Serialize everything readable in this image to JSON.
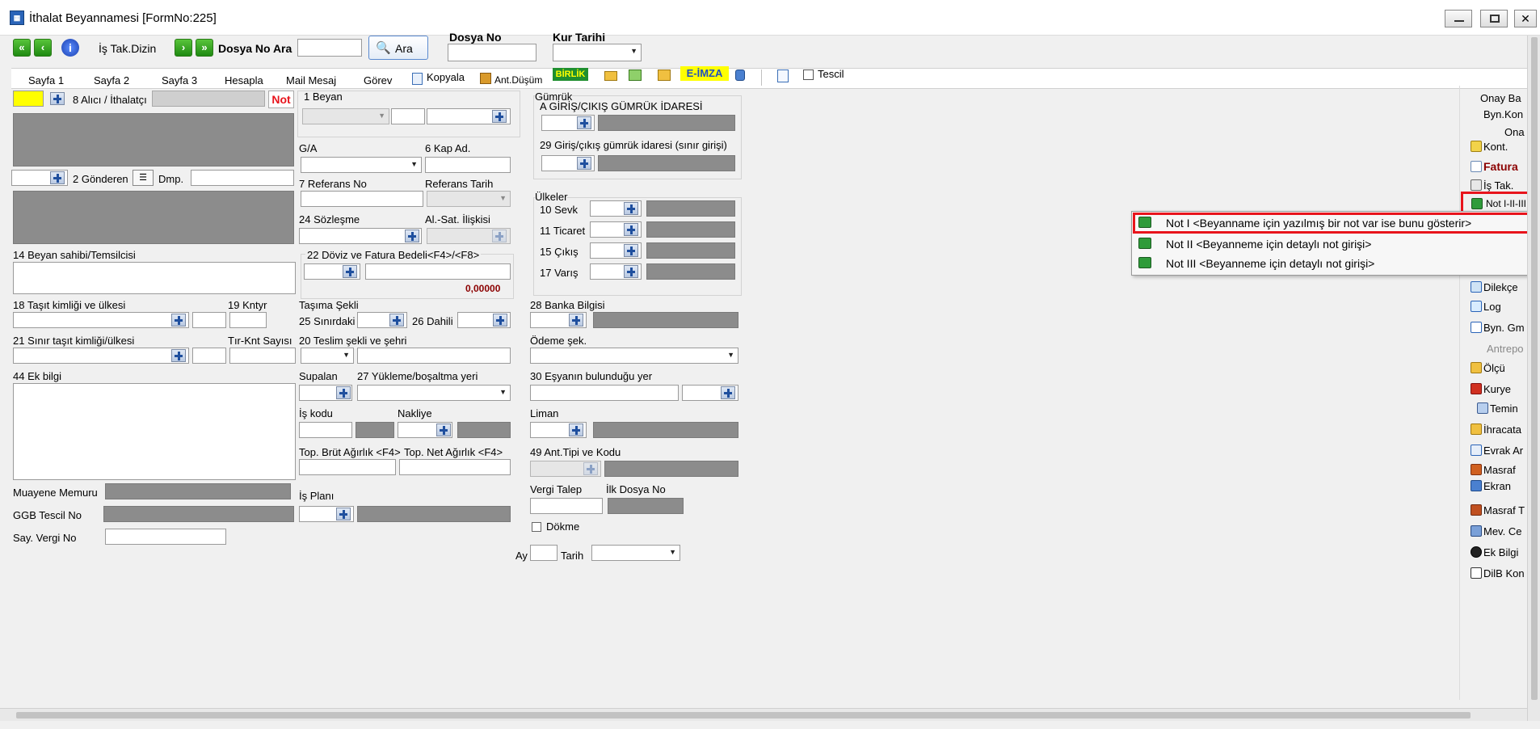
{
  "window": {
    "title": "İthalat Beyannamesi [FormNo:225]"
  },
  "toolbar": {
    "is_tak_dizin": "İş Tak.Dizin",
    "dosya_no_ara": "Dosya No Ara",
    "ara_button": "Ara",
    "dosya_no_label": "Dosya No",
    "kur_tarihi_label": "Kur Tarihi"
  },
  "tabs": [
    {
      "label": "Sayfa 1"
    },
    {
      "label": "Sayfa 2"
    },
    {
      "label": "Sayfa 3"
    },
    {
      "label": "Hesapla"
    },
    {
      "label": "Mail Mesaj"
    },
    {
      "label": "Görev"
    },
    {
      "label": "Kopyala"
    },
    {
      "label": "Ant.Düşüm"
    },
    {
      "label": "BİRLİK"
    },
    {
      "label": "E-İMZA"
    },
    {
      "label": "Tescil"
    }
  ],
  "left": {
    "alici": "8 Alıcı / İthalatçı",
    "not": "Not",
    "gonderen": "2 Gönderen",
    "dmp": "Dmp.",
    "beyan_sahibi": "14 Beyan sahibi/Temsilcisi",
    "tasit_kimligi": "18 Taşıt kimliği ve ülkesi",
    "kntyr": "19 Kntyr",
    "sinir_tasit": "21 Sınır taşıt kimliği/ülkesi",
    "tir_kont": "Tır-Knt Sayısı",
    "ek_bilgi": "44 Ek bilgi",
    "muayene": "Muayene Memuru",
    "ggb_tescil": "GGB Tescil No",
    "say_vergi": "Say. Vergi No"
  },
  "middle": {
    "beyan": "1 Beyan",
    "ga": "G/A",
    "kap_ad": "6 Kap Ad.",
    "referans_no": "7 Referans No",
    "referans_tarih": "Referans Tarih",
    "sozlesme": "24 Sözleşme",
    "alsat": "Al.-Sat. İlişkisi",
    "doviz": "22 Döviz ve Fatura Bedeli<F4>/<F8>",
    "doviz_value": "0,00000",
    "tasima_sekli": "Taşıma Şekli",
    "sinirdaki": "25 Sınırdaki",
    "dahili": "26 Dahili",
    "teslim": "20 Teslim şekli ve şehri",
    "supalan": "Supalan",
    "yukleme": "27 Yükleme/boşaltma yeri",
    "is_kodu": "İş kodu",
    "nakliye": "Nakliye",
    "brut": "Top. Brüt Ağırlık <F4>",
    "net": "Top. Net Ağırlık <F4>",
    "is_plani": "İş Planı"
  },
  "right": {
    "gumruk": "Gümrük",
    "giris_cikis": "A GİRİŞ/ÇIKIŞ GÜMRÜK İDARESİ",
    "sinir_girisi": "29 Giriş/çıkış gümrük idaresi (sınır girişi)",
    "ulkeler": "Ülkeler",
    "sevk": "10 Sevk",
    "ticaret": "11 Ticaret",
    "cikis": "15 Çıkış",
    "varis": "17 Varış",
    "banka": "28 Banka Bilgisi",
    "odeme": "Ödeme şek.",
    "esyanin": "30 Eşyanın bulunduğu yer",
    "liman": "Liman",
    "ant_tipi": "49 Ant.Tipi ve Kodu",
    "vergi_talep": "Vergi Talep",
    "ilk_dosya": "İlk Dosya No",
    "dokme": "Dökme",
    "ay": "Ay",
    "tarih": "Tarih"
  },
  "sidebar": {
    "items": [
      {
        "label": "Onay Ba"
      },
      {
        "label": "Byn.Kon"
      },
      {
        "label": "Ona"
      },
      {
        "label": "Kont."
      },
      {
        "label": "Fatura"
      },
      {
        "label": "İş Tak."
      },
      {
        "label": "Not I-II-III"
      },
      {
        "label": "Dilekçe"
      },
      {
        "label": "Log"
      },
      {
        "label": "Byn. Gm"
      },
      {
        "label": "Antrepo"
      },
      {
        "label": "Ölçü"
      },
      {
        "label": "Kurye"
      },
      {
        "label": "Temin"
      },
      {
        "label": "İhracata"
      },
      {
        "label": "Evrak Ar"
      },
      {
        "label": "Masraf"
      },
      {
        "label": "Ekran"
      },
      {
        "label": "Masraf T"
      },
      {
        "label": "Mev. Ce"
      },
      {
        "label": "Ek Bilgi"
      },
      {
        "label": "DilB Kon"
      }
    ]
  },
  "context_menu": {
    "items": [
      {
        "label": "Not I <Beyanname için yazılmış bir not var ise bunu gösterir>"
      },
      {
        "label": "Not II <Beyanneme için detaylı not girişi>"
      },
      {
        "label": "Not III <Beyanneme için detaylı not girişi>"
      }
    ]
  },
  "colors": {
    "highlight": "#e8141c",
    "accent_yellow": "#ffff00",
    "value_red": "#8b0000"
  }
}
